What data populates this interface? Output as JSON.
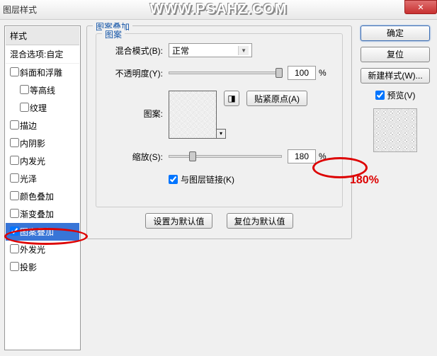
{
  "window": {
    "title": "图层样式"
  },
  "watermark": "WWW.PSAHZ.COM",
  "left": {
    "header": "样式",
    "blend": "混合选项:自定",
    "items": [
      {
        "label": "斜面和浮雕",
        "checked": false,
        "indent": false
      },
      {
        "label": "等高线",
        "checked": false,
        "indent": true
      },
      {
        "label": "纹理",
        "checked": false,
        "indent": true
      },
      {
        "label": "描边",
        "checked": false,
        "indent": false
      },
      {
        "label": "内阴影",
        "checked": false,
        "indent": false
      },
      {
        "label": "内发光",
        "checked": false,
        "indent": false
      },
      {
        "label": "光泽",
        "checked": false,
        "indent": false
      },
      {
        "label": "颜色叠加",
        "checked": false,
        "indent": false
      },
      {
        "label": "渐变叠加",
        "checked": false,
        "indent": false
      },
      {
        "label": "图案叠加",
        "checked": true,
        "indent": false,
        "selected": true
      },
      {
        "label": "外发光",
        "checked": false,
        "indent": false
      },
      {
        "label": "投影",
        "checked": false,
        "indent": false
      }
    ]
  },
  "center": {
    "group_title": "图案叠加",
    "inner_title": "图案",
    "blend_label": "混合模式(B):",
    "blend_value": "正常",
    "opacity_label": "不透明度(Y):",
    "opacity_value": "100",
    "pct": "%",
    "pattern_label": "图案:",
    "snap_btn": "贴紧原点(A)",
    "scale_label": "缩放(S):",
    "scale_value": "180",
    "link_label": "与图层链接(K)",
    "default_btn": "设置为默认值",
    "reset_btn": "复位为默认值"
  },
  "right": {
    "ok": "确定",
    "cancel": "复位",
    "newstyle": "新建样式(W)...",
    "preview": "预览(V)"
  },
  "annotation": "180%"
}
